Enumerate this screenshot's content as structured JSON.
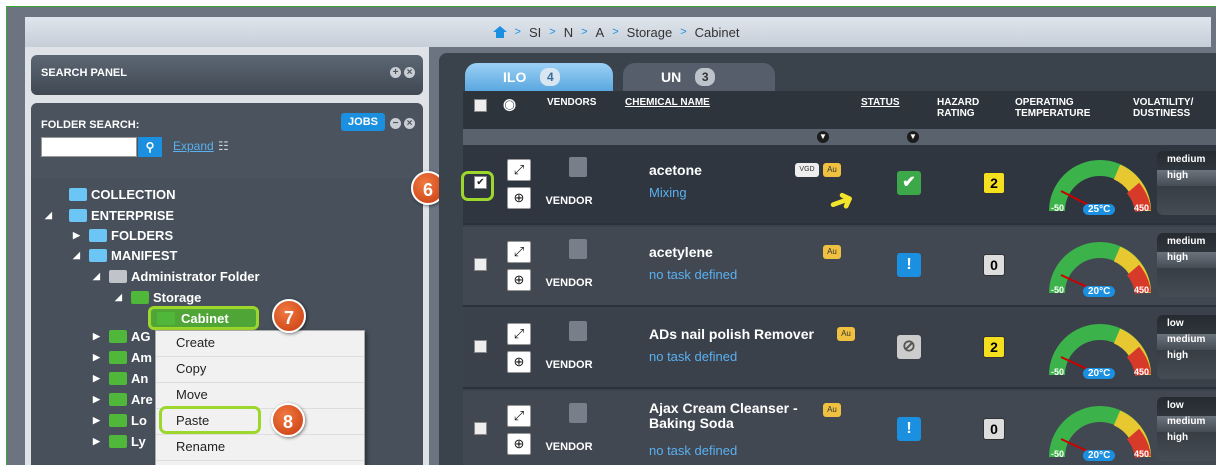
{
  "breadcrumb": {
    "items": [
      "SI",
      "N",
      "A",
      "Storage",
      "Cabinet"
    ]
  },
  "search_panel": {
    "title": "SEARCH PANEL"
  },
  "folder_search": {
    "title": "FOLDER SEARCH:",
    "jobs_label": "JOBS",
    "search_placeholder": "",
    "expand_label": "Expand",
    "tree": {
      "collection": "COLLECTION",
      "enterprise": "ENTERPRISE",
      "folders": "FOLDERS",
      "manifest": "MANIFEST",
      "admin_folder": "Administrator Folder",
      "storage": "Storage",
      "cabinet": "Cabinet",
      "ag": "AG",
      "am": "Am",
      "an": "An",
      "are": "Are",
      "lo": "Lo",
      "ly": "Ly"
    }
  },
  "context_menu": {
    "items": [
      "Create",
      "Copy",
      "Move",
      "Paste",
      "Rename"
    ]
  },
  "callouts": {
    "step6": "6",
    "step7": "7",
    "step8": "8"
  },
  "tabs": [
    {
      "label": "ILO",
      "count": "4"
    },
    {
      "label": "UN",
      "count": "3"
    }
  ],
  "columns": {
    "vendors": "VENDORS",
    "chemical_name": "CHEMICAL NAME",
    "status": "STATUS",
    "hazard_rating": "HAZARD RATING",
    "operating_temperature": "OPERATING TEMPERATURE",
    "volatility": "VOLATILITY/ DUSTINESS"
  },
  "rows": [
    {
      "vendor": "VENDOR",
      "name": "acetone",
      "task": "Mixing",
      "vgd": "VGD",
      "au": "Au",
      "status": "✔",
      "hazard": "2",
      "temp": "25°C",
      "min": "-50",
      "max": "450",
      "vol": [
        "medium",
        "high"
      ]
    },
    {
      "vendor": "VENDOR",
      "name": "acetylene",
      "task": "no task defined",
      "au": "Au",
      "status": "!",
      "hazard": "0",
      "temp": "20°C",
      "min": "-50",
      "max": "450",
      "vol": [
        "medium",
        "high"
      ]
    },
    {
      "vendor": "VENDOR",
      "name": "ADs nail polish Remover",
      "task": "no task defined",
      "au": "Au",
      "status": "⊘",
      "hazard": "2",
      "temp": "20°C",
      "min": "-50",
      "max": "450",
      "vol": [
        "low",
        "medium",
        "high"
      ]
    },
    {
      "vendor": "VENDOR",
      "name": "Ajax Cream Cleanser - Baking Soda",
      "task": "no task defined",
      "au": "Au",
      "status": "!",
      "hazard": "0",
      "temp": "20°C",
      "min": "-50",
      "max": "450",
      "vol": [
        "low",
        "medium",
        "high"
      ]
    }
  ],
  "colors": {
    "accent": "#1b8fe0",
    "highlight": "#9ed72c",
    "callout": "#e0541f"
  }
}
